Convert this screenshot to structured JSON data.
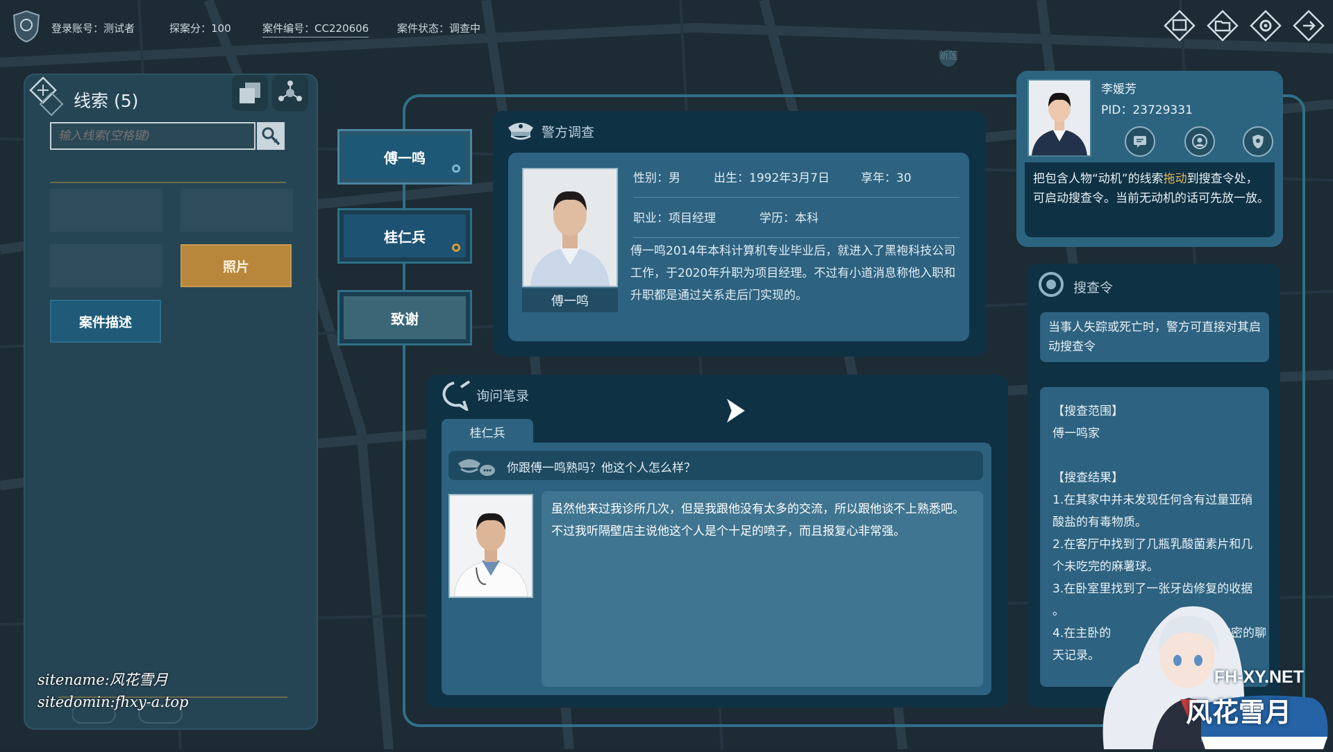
{
  "topbar": {
    "account": "登录账号：测试者",
    "score": "探案分：100",
    "case_number": "案件编号：CC220606",
    "case_status": "案件状态：调查中",
    "icons": [
      "archive-icon",
      "folder-icon",
      "gear-icon",
      "exit-icon"
    ]
  },
  "map": {
    "place_label": "新莲"
  },
  "clues": {
    "title": "线索 (5)",
    "search_placeholder": "输入线索(空格键)",
    "photo_label": "照片",
    "case_desc_label": "案件描述"
  },
  "suspects": {
    "tabs": [
      "傅一鸣",
      "桂仁兵",
      "致谢"
    ]
  },
  "police_investigation": {
    "title": "警方调查",
    "name": "傅一鸣",
    "gender": "性别：男",
    "birth": "出生：1992年3月7日",
    "age": "享年：30",
    "job": "职业：项目经理",
    "education": "学历：本科",
    "bio": "傅一鸣2014年本科计算机专业毕业后，就进入了黑袍科技公司工作，于2020年升职为项目经理。不过有小道消息称他入职和升职都是通过关系走后门实现的。"
  },
  "interview": {
    "title": "询问笔录",
    "tab": "桂仁兵",
    "question": "你跟傅一鸣熟吗？他这个人怎么样？",
    "answer": "虽然他来过我诊所几次，但是我跟他没有太多的交流，所以跟他谈不上熟悉吧。不过我听隔壁店主说他这个人是个十足的喷子，而且报复心非常强。"
  },
  "officer": {
    "name": "李媛芳",
    "pid": "PID：23729331",
    "tip_before": "把包含人物“动机”的线索",
    "tip_highlight": "拖动",
    "tip_after": "到搜查令处，可启动搜查令。当前无动机的话可先放一放。"
  },
  "warrant": {
    "title": "搜查令",
    "note": "当事人失踪或死亡时，警方可直接对其启动搜查令",
    "lines": [
      "【搜查范围】",
      "傅一鸣家",
      "【搜查结果】",
      "1.在其家中并未发现任何含有过量亚硝",
      "酸盐的有毒物质。",
      "2.在客厅中找到了几瓶乳酸菌素片和几",
      "个未吃完的麻薯球。",
      "3.在卧室里找到了一张牙齿修复的收据",
      "。",
      "4.在主卧的",
      "现了很多加密的聊",
      "天记录。"
    ]
  },
  "watermark": {
    "sitename": "sitename:风花雪月",
    "sitedomain": "sitedomin:fhxy-a.top",
    "brand_en": "FH-XY.NET",
    "brand_cn": "风花雪月"
  },
  "colors": {
    "accent_gold": "#b8873b",
    "accent_blue": "#1f5a78",
    "highlight": "#e2b85a",
    "panel_dark": "#0f3144",
    "panel_mid": "#2d6280"
  }
}
